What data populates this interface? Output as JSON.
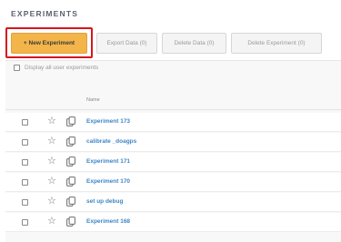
{
  "page": {
    "title": "EXPERIMENTS"
  },
  "toolbar": {
    "new_experiment": "+ New Experiment",
    "export_data": "Export Data (0)",
    "delete_data": "Delete Data (0)",
    "delete_experiment": "Delete Experiment (0)"
  },
  "filters": {
    "display_all_label": "Display all user experiments"
  },
  "table": {
    "name_header": "Name",
    "rows": [
      {
        "name": "Experiment 173"
      },
      {
        "name": "calibrate _doagps"
      },
      {
        "name": "Experiment 171"
      },
      {
        "name": "Experiment 170"
      },
      {
        "name": "set up debug"
      },
      {
        "name": "Experiment 168"
      }
    ]
  },
  "colors": {
    "primary_button": "#f3b54a",
    "highlight_border": "#d6171d",
    "link": "#3f86c7"
  }
}
